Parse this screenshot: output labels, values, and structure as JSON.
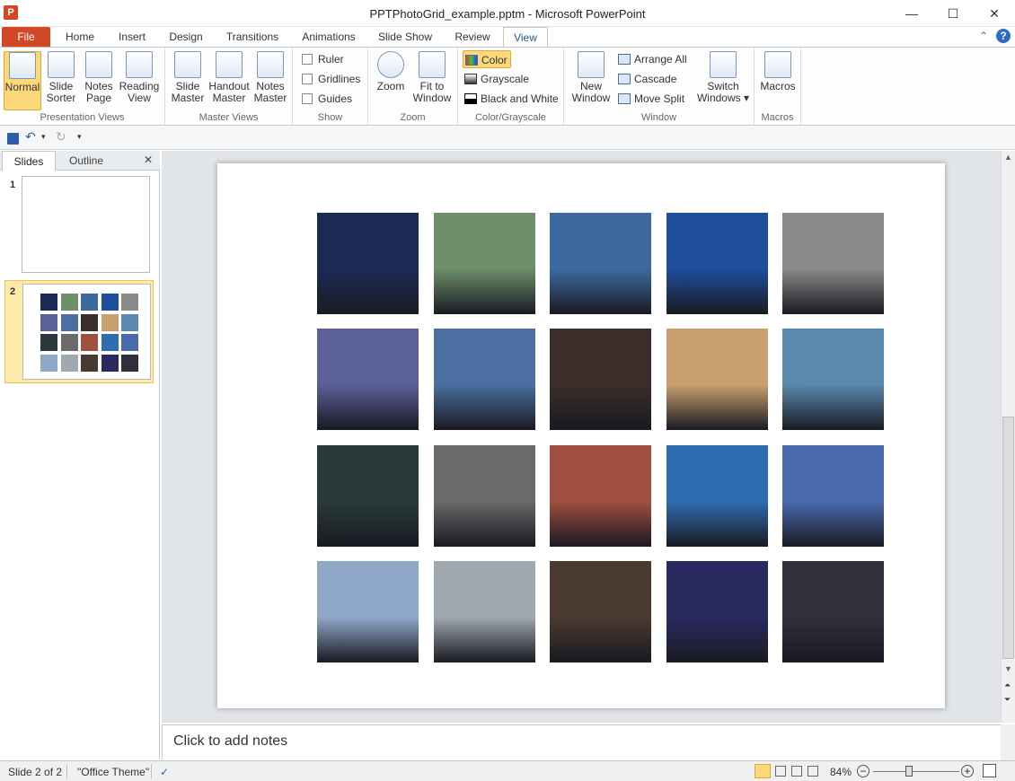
{
  "window": {
    "title": "PPTPhotoGrid_example.pptm - Microsoft PowerPoint",
    "minimize": "—",
    "maximize": "☐",
    "close": "✕",
    "app_icon": "P"
  },
  "tabs": [
    "File",
    "Home",
    "Insert",
    "Design",
    "Transitions",
    "Animations",
    "Slide Show",
    "Review",
    "View"
  ],
  "active_tab": "View",
  "ribbon": {
    "presentation_views": {
      "label": "Presentation Views",
      "normal": "Normal",
      "slide_sorter": [
        "Slide",
        "Sorter"
      ],
      "notes_page": [
        "Notes",
        "Page"
      ],
      "reading_view": [
        "Reading",
        "View"
      ]
    },
    "master_views": {
      "label": "Master Views",
      "slide_master": [
        "Slide",
        "Master"
      ],
      "handout_master": [
        "Handout",
        "Master"
      ],
      "notes_master": [
        "Notes",
        "Master"
      ]
    },
    "show": {
      "label": "Show",
      "ruler": "Ruler",
      "gridlines": "Gridlines",
      "guides": "Guides"
    },
    "zoom": {
      "label": "Zoom",
      "zoom": "Zoom",
      "fit_to_window": [
        "Fit to",
        "Window"
      ]
    },
    "color": {
      "label": "Color/Grayscale",
      "color": "Color",
      "grayscale": "Grayscale",
      "black_white": "Black and White"
    },
    "window": {
      "label": "Window",
      "new_window": [
        "New",
        "Window"
      ],
      "arrange_all": "Arrange All",
      "cascade": "Cascade",
      "move_split": "Move Split",
      "switch_windows": [
        "Switch",
        "Windows ▾"
      ]
    },
    "macros": {
      "label": "Macros",
      "macros": "Macros"
    }
  },
  "pane": {
    "tab_slides": "Slides",
    "tab_outline": "Outline",
    "close": "✕",
    "slide1_num": "1",
    "slide2_num": "2"
  },
  "notes": {
    "placeholder": "Click to add notes"
  },
  "status": {
    "slide": "Slide 2 of 2",
    "theme": "\"Office Theme\"",
    "zoom": "84%"
  },
  "photos": [
    [
      "#1a2a55",
      "#6d8f6a",
      "#3c6aa0",
      "#1f4f9c",
      "#8a8a8a"
    ],
    [
      "#5b5f9a",
      "#4a6fa0",
      "#3b2e2a",
      "#c8a070",
      "#5a8ab0"
    ],
    [
      "#2a3a3a",
      "#6a6a6a",
      "#a05040",
      "#2f6db0",
      "#4a6ab0"
    ],
    [
      "#8fa8c8",
      "#a0a8b0",
      "#4a3a30",
      "#2a2a60",
      "#30303a"
    ]
  ]
}
